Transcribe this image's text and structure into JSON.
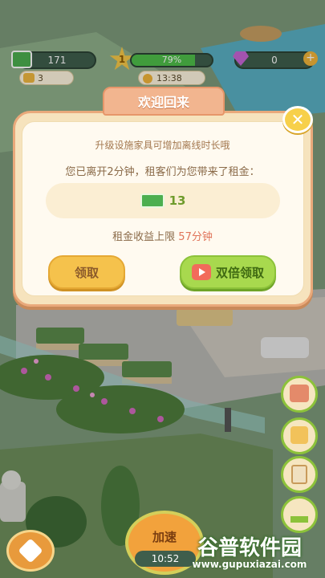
{
  "hud": {
    "cash": "171",
    "level": "1",
    "progress_text": "79%",
    "progress": 0.79,
    "gems": "0",
    "sub_count": "3",
    "timer": "13:38"
  },
  "dialog": {
    "title": "欢迎回来",
    "tip": "升级设施家具可增加离线时长哦",
    "message": "您已离开2分钟，租客们为您带来了租金：",
    "reward_amount": "13",
    "limit_prefix": "租金收益上限 ",
    "limit_value": "57分钟",
    "collect_label": "领取",
    "double_label": "双倍领取"
  },
  "bottom": {
    "speed_label": "加速",
    "speed_timer": "10:52"
  },
  "watermark": {
    "brand": "谷普软件园",
    "url": "www.gupuxiazai.com"
  },
  "colors": {
    "accent_green": "#8cc23a",
    "accent_yellow": "#f5c24c",
    "accent_orange": "#e6966a",
    "text_brown": "#a3784f",
    "limit_red": "#e0745a"
  }
}
